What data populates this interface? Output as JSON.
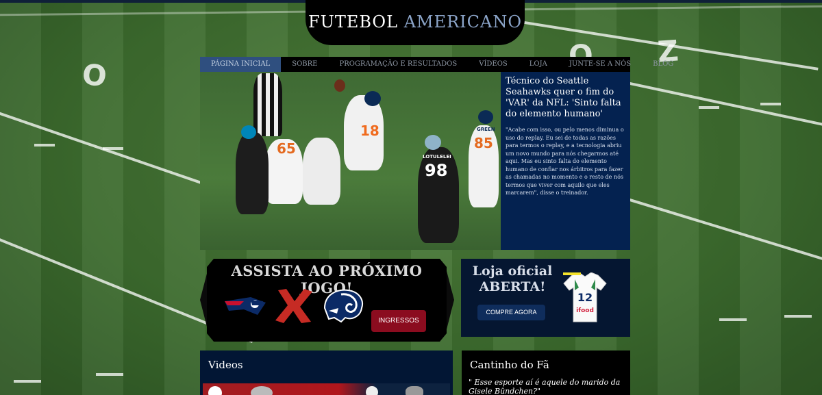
{
  "header": {
    "title_part1": "FUTEBOL",
    "title_part2": "AMERICANO"
  },
  "nav": {
    "items": [
      {
        "label": "PÁGINA INICIAL",
        "active": true
      },
      {
        "label": "SOBRE"
      },
      {
        "label": "PROGRAMAÇÃO E RESULTADOS"
      },
      {
        "label": "VÍDEOS"
      },
      {
        "label": "LOJA"
      },
      {
        "label": "JUNTE-SE A NÓS"
      },
      {
        "label": "BLOG"
      }
    ]
  },
  "hero": {
    "jersey_numbers": [
      "18",
      "65",
      "85",
      "98"
    ],
    "jersey_names": [
      "GREEN",
      "LOTULELEI"
    ]
  },
  "news": {
    "headline": "Técnico do Seattle Seahawks quer o fim do 'VAR' da NFL: 'Sinto falta do elemento humano'",
    "body": "\"Acabe com isso, ou pelo menos diminua o uso do replay. Eu sei de todas as razões para termos o replay, e a tecnologia abriu um novo mundo para nós chegarmos até aqui. Mas eu sinto falta do elemento humano de confiar nos árbitros para fazer as chamadas no momento e o resto de nós termos que viver com aquilo que eles marcarem\", disse o treinador."
  },
  "next_game": {
    "title": "ASSISTA AO PRÓXIMO JOGO!",
    "button_label": "INGRESSOS",
    "teams_icons": [
      "patriots-logo",
      "versus-x-icon",
      "rams-logo"
    ]
  },
  "store": {
    "title": "Loja oficial ABERTA!",
    "button_label": "COMPRE AGORA",
    "jersey": {
      "number": "12",
      "sponsor": "ifood"
    }
  },
  "videos": {
    "title": "Videos"
  },
  "fan_corner": {
    "title": "Cantinho do Fã",
    "quote": "\" Esse esporte aí é aquele do marido da Gisele Bündchen?\""
  },
  "colors": {
    "accent_navy": "#042250",
    "nav_active": "#2f4f7f",
    "ticket_red": "#8b0c1f",
    "field_green": "#3d6c2e"
  }
}
